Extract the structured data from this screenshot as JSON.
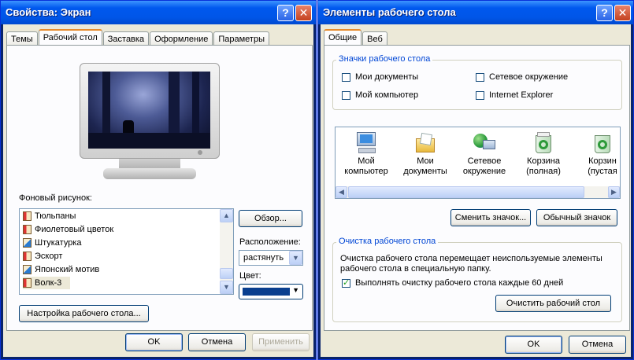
{
  "left_window": {
    "title": "Свойства: Экран",
    "tabs": [
      "Темы",
      "Рабочий стол",
      "Заставка",
      "Оформление",
      "Параметры"
    ],
    "background_label": "Фоновый рисунок:",
    "wallpapers": [
      "Тюльпаны",
      "Фиолетовый цветок",
      "Штукатурка",
      "Эскорт",
      "Японский мотив",
      "Волк-3"
    ],
    "selected_wallpaper": "Волк-3",
    "browse_button": "Обзор...",
    "position_label": "Расположение:",
    "position_value": "растянуть",
    "color_label": "Цвет:",
    "color_value": "#0a3f8f",
    "customize_button": "Настройка рабочего стола...",
    "ok": "OK",
    "cancel": "Отмена",
    "apply": "Применить"
  },
  "right_window": {
    "title": "Элементы рабочего стола",
    "tabs": [
      "Общие",
      "Веб"
    ],
    "icons_group": "Значки рабочего стола",
    "checkboxes": [
      {
        "label": "Мои документы",
        "checked": false
      },
      {
        "label": "Сетевое окружение",
        "checked": false
      },
      {
        "label": "Мой компьютер",
        "checked": false
      },
      {
        "label": "Internet Explorer",
        "checked": false
      }
    ],
    "icons": [
      {
        "label": "Мой компьютер",
        "icon": "my-computer-icon"
      },
      {
        "label": "Мои документы",
        "icon": "my-documents-icon"
      },
      {
        "label": "Сетевое окружение",
        "icon": "network-icon"
      },
      {
        "label": "Корзина (полная)",
        "icon": "recycle-bin-full-icon"
      },
      {
        "label": "Корзин (пустая",
        "icon": "recycle-bin-empty-icon"
      }
    ],
    "icon_labels": {
      "i0a": "Мой",
      "i0b": "компьютер",
      "i1a": "Мои",
      "i1b": "документы",
      "i2a": "Сетевое",
      "i2b": "окружение",
      "i3a": "Корзина",
      "i3b": "(полная)",
      "i4a": "Корзин",
      "i4b": "(пустая"
    },
    "change_icon_button": "Сменить значок...",
    "default_icon_button": "Обычный значок",
    "cleanup_group": "Очистка рабочего стола",
    "cleanup_text_1": "Очистка рабочего стола перемещает неиспользуемые элементы",
    "cleanup_text_2": "рабочего стола в специальную папку.",
    "cleanup_checkbox": "Выполнять очистку рабочего стола каждые 60 дней",
    "cleanup_checked": true,
    "cleanup_button": "Очистить рабочий стол",
    "ok": "OK",
    "cancel": "Отмена"
  }
}
